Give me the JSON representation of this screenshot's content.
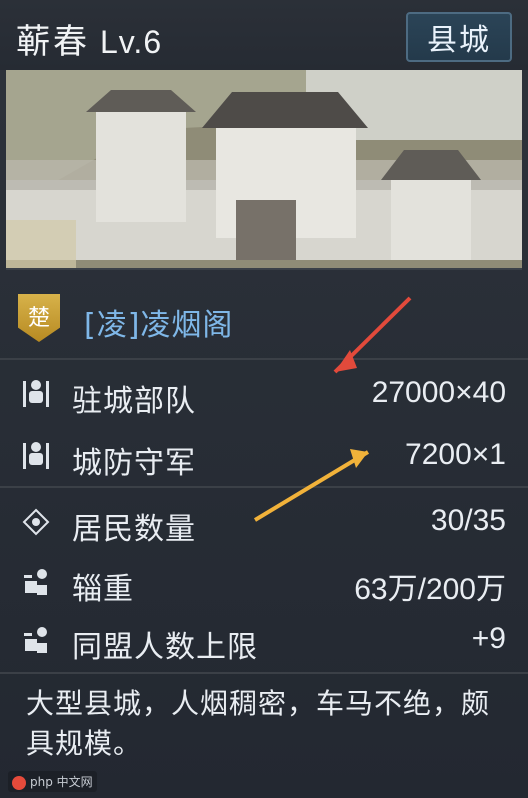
{
  "header": {
    "city_name": "蕲春",
    "level": "Lv.6",
    "type_badge": "县城"
  },
  "faction": {
    "badge_char": "楚",
    "name": "[凌]凌烟阁",
    "color": "#7fb7e8"
  },
  "stats": [
    {
      "icon": "soldier-icon",
      "label": "驻城部队",
      "value": "27000×40"
    },
    {
      "icon": "soldier-icon",
      "label": "城防守军",
      "value": "7200×1"
    },
    {
      "icon": "diamond-target-icon",
      "label": "居民数量",
      "value": "30/35"
    },
    {
      "icon": "supply-icon",
      "label": "辎重",
      "value": "63万/200万"
    },
    {
      "icon": "supply-icon",
      "label": "同盟人数上限",
      "value": "+9"
    }
  ],
  "description": "大型县城，人烟稠密，车马不绝，颇具规模。",
  "annotations": {
    "red_arrow": "#e24a3b",
    "yellow_arrow": "#f1b23a"
  },
  "watermark": "php 中文网"
}
